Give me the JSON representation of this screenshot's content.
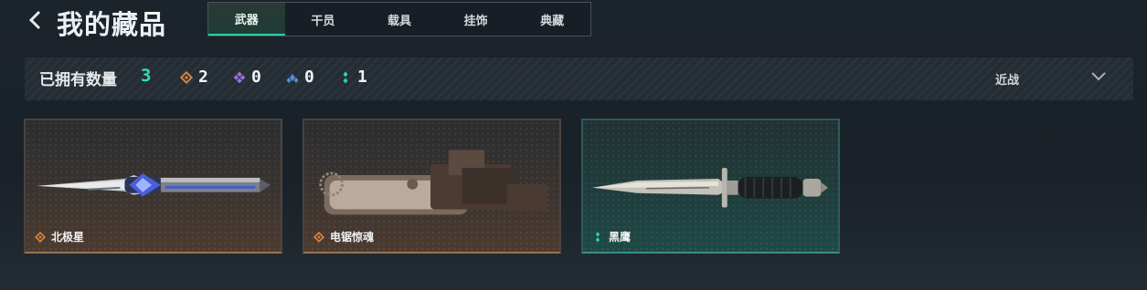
{
  "header": {
    "title": "我的藏品",
    "tabs": [
      {
        "label": "武器",
        "active": true
      },
      {
        "label": "干员",
        "active": false
      },
      {
        "label": "载具",
        "active": false
      },
      {
        "label": "挂饰",
        "active": false
      },
      {
        "label": "典藏",
        "active": false
      }
    ]
  },
  "stats": {
    "owned_label": "已拥有数量",
    "owned_count": "3",
    "rarities": [
      {
        "icon": "orange-diamond-icon",
        "color": "#d9823e",
        "count": "2"
      },
      {
        "icon": "purple-diamond-icon",
        "color": "#9b6fe0",
        "count": "0"
      },
      {
        "icon": "blue-triangle-icon",
        "color": "#4e8fd6",
        "count": "0"
      },
      {
        "icon": "green-dots-icon",
        "color": "#2ad6a6",
        "count": "1"
      }
    ],
    "filter_label": "近战"
  },
  "items": [
    {
      "name": "北极星",
      "rarity_icon": "orange-diamond-icon",
      "rarity_color": "#d9823e"
    },
    {
      "name": "电锯惊魂",
      "rarity_icon": "orange-diamond-icon",
      "rarity_color": "#d9823e"
    },
    {
      "name": "黑鹰",
      "rarity_icon": "green-dots-icon",
      "rarity_color": "#2ad6a6"
    }
  ],
  "colors": {
    "accent": "#2ce0ad"
  }
}
